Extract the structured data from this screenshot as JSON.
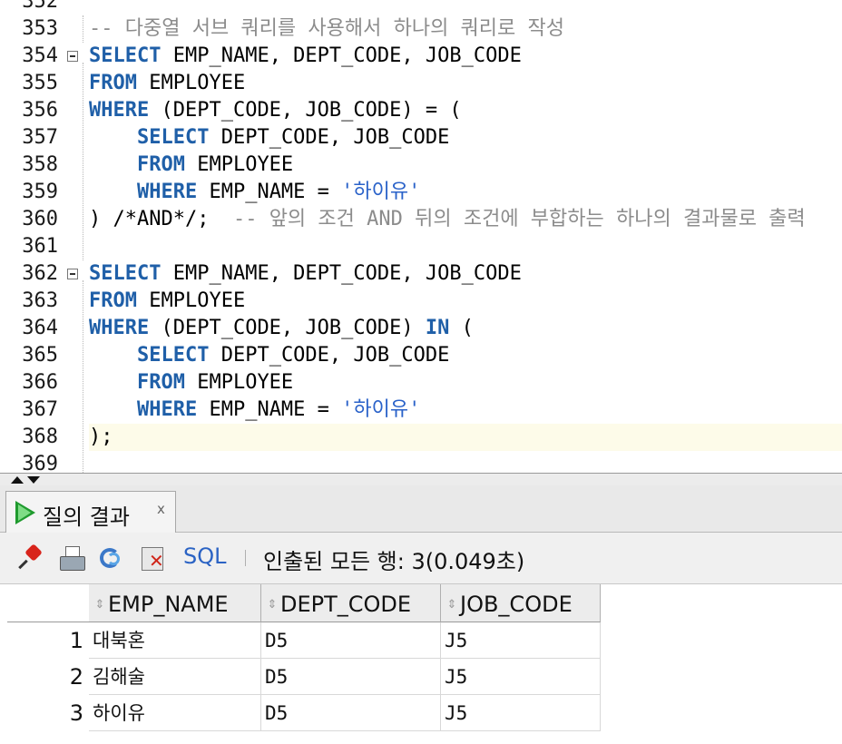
{
  "editor": {
    "lines": [
      {
        "num": "352",
        "text": ""
      },
      {
        "num": "353",
        "text": "-- 다중열 서브 쿼리를 사용해서 하나의 쿼리로 작성"
      },
      {
        "num": "354",
        "text": "SELECT EMP_NAME, DEPT_CODE, JOB_CODE"
      },
      {
        "num": "355",
        "text": "FROM EMPLOYEE"
      },
      {
        "num": "356",
        "text": "WHERE (DEPT_CODE, JOB_CODE) = ("
      },
      {
        "num": "357",
        "text": "    SELECT DEPT_CODE, JOB_CODE"
      },
      {
        "num": "358",
        "text": "    FROM EMPLOYEE"
      },
      {
        "num": "359",
        "text": "    WHERE EMP_NAME = '하이유'"
      },
      {
        "num": "360",
        "text": ") /*AND*/;  -- 앞의 조건 AND 뒤의 조건에 부합하는 하나의 결과물로 출력"
      },
      {
        "num": "361",
        "text": ""
      },
      {
        "num": "362",
        "text": "SELECT EMP_NAME, DEPT_CODE, JOB_CODE"
      },
      {
        "num": "363",
        "text": "FROM EMPLOYEE"
      },
      {
        "num": "364",
        "text": "WHERE (DEPT_CODE, JOB_CODE) IN ("
      },
      {
        "num": "365",
        "text": "    SELECT DEPT_CODE, JOB_CODE"
      },
      {
        "num": "366",
        "text": "    FROM EMPLOYEE"
      },
      {
        "num": "367",
        "text": "    WHERE EMP_NAME = '하이유'"
      },
      {
        "num": "368",
        "text": ");"
      },
      {
        "num": "369",
        "text": ""
      }
    ],
    "current_line": "368"
  },
  "results": {
    "tab_label": "질의 결과",
    "tab_close": "x",
    "toolbar": {
      "sql_label": "SQL",
      "status": "인출된 모든 행: 3(0.049초)"
    },
    "columns": [
      "EMP_NAME",
      "DEPT_CODE",
      "JOB_CODE"
    ],
    "rows": [
      {
        "num": "1",
        "cells": [
          "대북혼",
          "D5",
          "J5"
        ]
      },
      {
        "num": "2",
        "cells": [
          "김해술",
          "D5",
          "J5"
        ]
      },
      {
        "num": "3",
        "cells": [
          "하이유",
          "D5",
          "J5"
        ]
      }
    ]
  },
  "colors": {
    "keyword": "#1f5fa8",
    "comment": "#8c8c8c",
    "string": "#2a62c9",
    "current_line_bg": "#fdfbe9",
    "run_icon": "#1f9a2e"
  },
  "icons": [
    "fold-icon",
    "run-triangle-icon",
    "close-icon",
    "pin-icon",
    "print-icon",
    "refresh-icon",
    "clear-icon",
    "sort-icon"
  ]
}
